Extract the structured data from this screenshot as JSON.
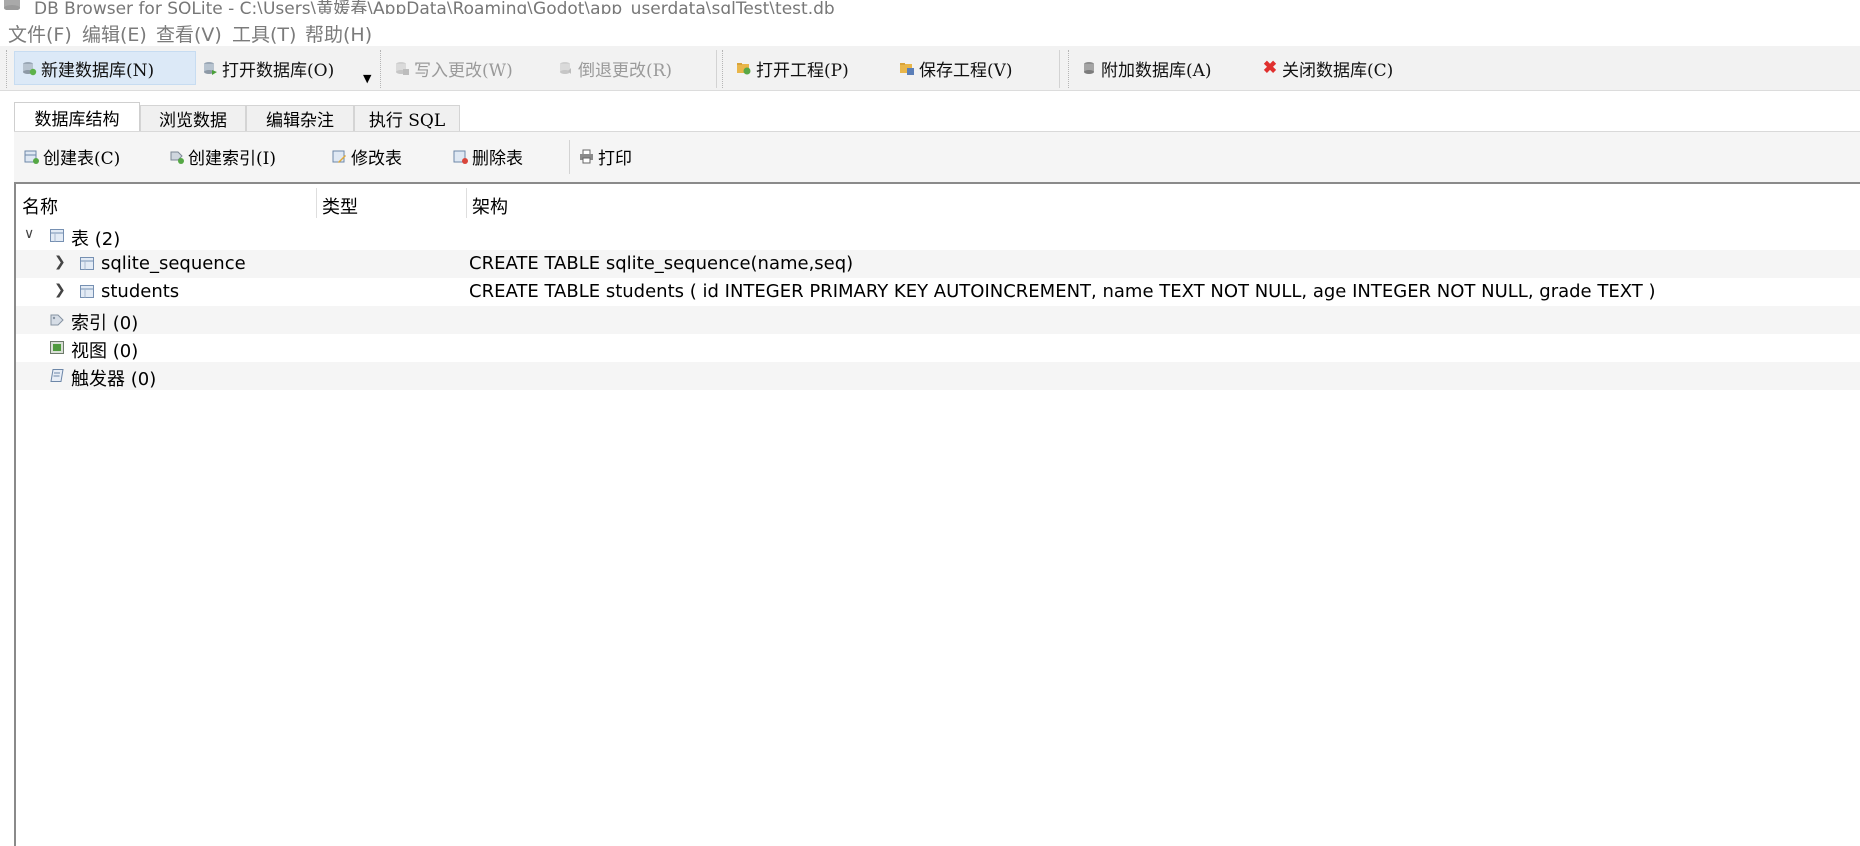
{
  "window": {
    "title": "DB Browser for SQLite - C:\\Users\\黄媛春\\AppData\\Roaming\\Godot\\app_userdata\\sqlTest\\test.db"
  },
  "menu": [
    "文件(F)",
    "编辑(E)",
    "查看(V)",
    "工具(T)",
    "帮助(H)"
  ],
  "toolbar": {
    "new_db": "新建数据库(N)",
    "open_db": "打开数据库(O)",
    "write_changes": "写入更改(W)",
    "revert_changes": "倒退更改(R)",
    "open_project": "打开工程(P)",
    "save_project": "保存工程(V)",
    "attach_db": "附加数据库(A)",
    "close_db": "关闭数据库(C)"
  },
  "tabs": [
    "数据库结构",
    "浏览数据",
    "编辑杂注",
    "执行 SQL"
  ],
  "subtoolbar": {
    "create_table": "创建表(C)",
    "create_index": "创建索引(I)",
    "modify_table": "修改表",
    "delete_table": "删除表",
    "print": "打印"
  },
  "tree": {
    "columns": [
      "名称",
      "类型",
      "架构"
    ],
    "tables_group": "表 (2)",
    "tables": [
      {
        "name": "sqlite_sequence",
        "schema": "CREATE TABLE sqlite_sequence(name,seq)"
      },
      {
        "name": "students",
        "schema": "CREATE TABLE students ( id INTEGER PRIMARY KEY AUTOINCREMENT, name TEXT NOT NULL, age INTEGER NOT NULL, grade TEXT )"
      }
    ],
    "indexes_group": "索引 (0)",
    "views_group": "视图 (0)",
    "triggers_group": "触发器 (0)"
  },
  "colors": {
    "close_x": "#e0302e",
    "active_bg": "#dce9f7",
    "tab_bg": "#f0f0f0",
    "tree_alt": "#f5f5f5"
  }
}
